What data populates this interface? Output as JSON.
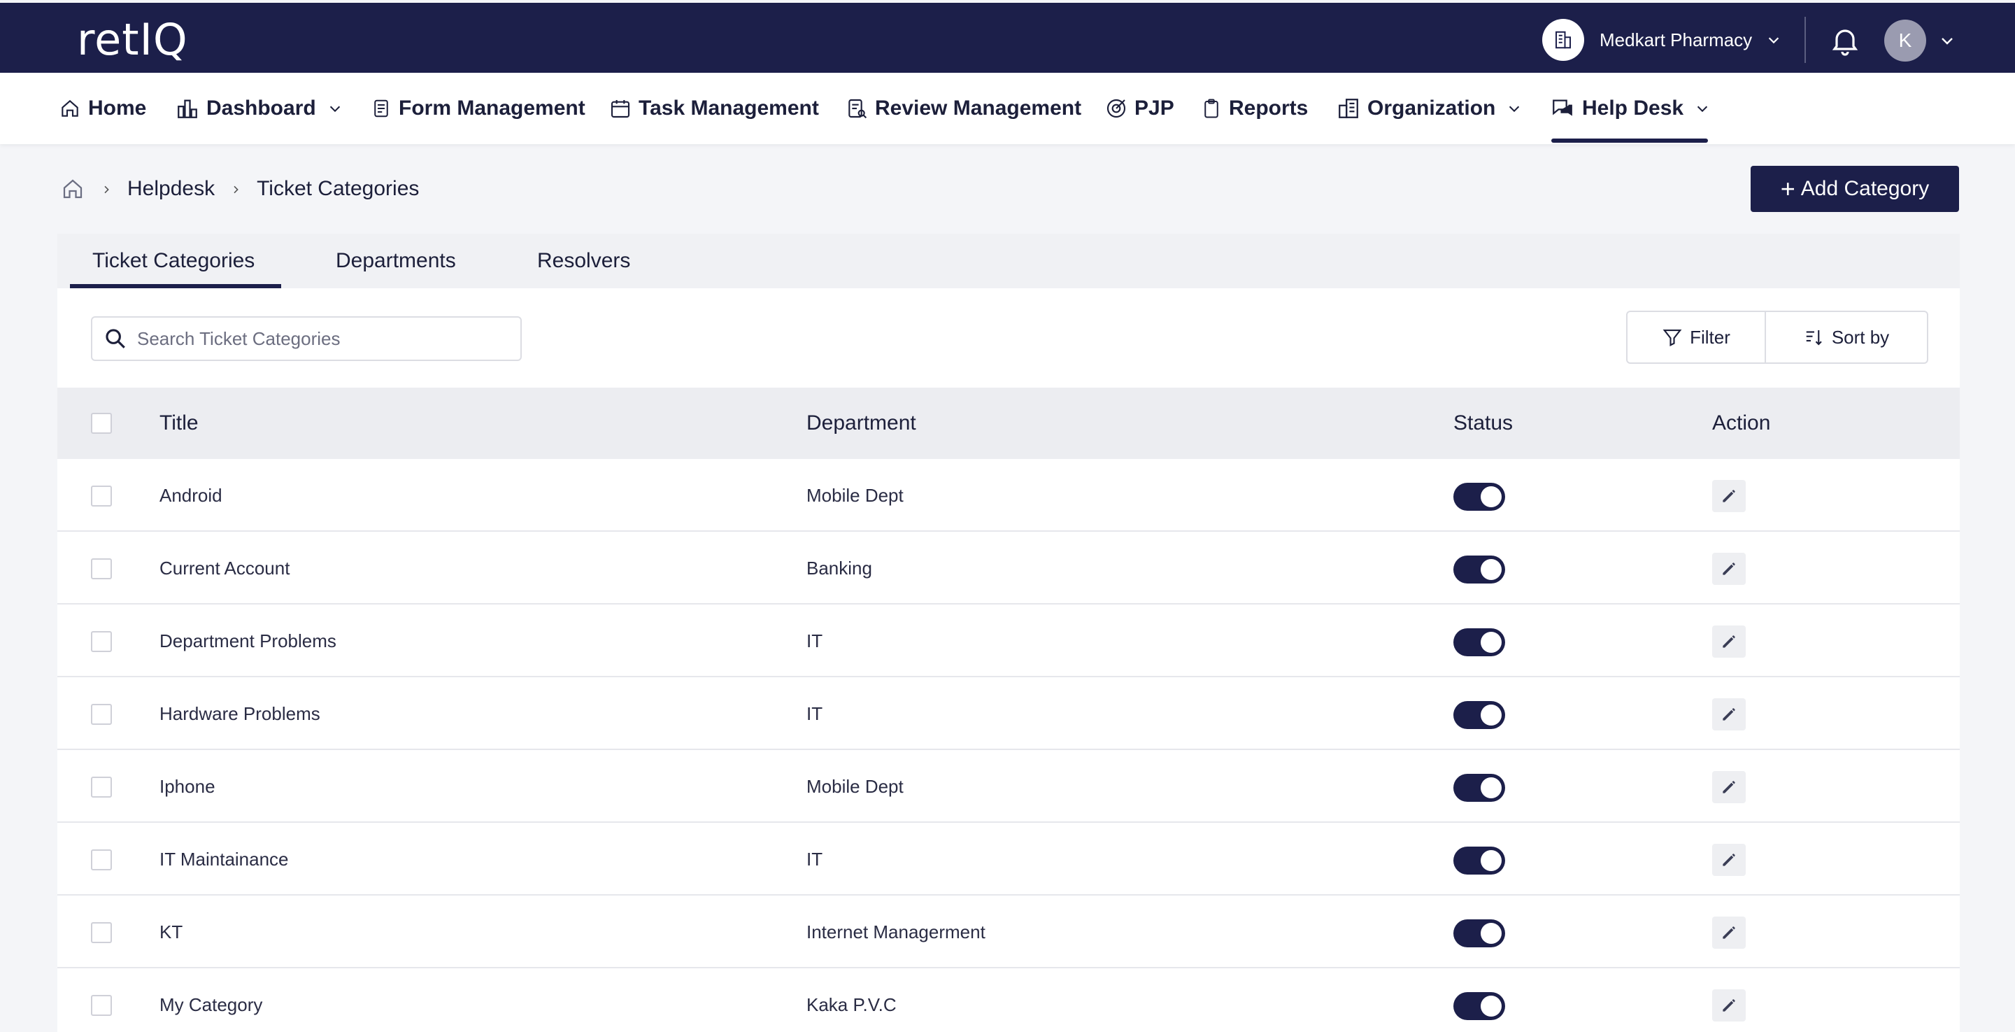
{
  "brand": {
    "logo_text": "retIQ"
  },
  "topbar": {
    "store_name": "Medkart Pharmacy",
    "avatar_initial": "K"
  },
  "nav": [
    {
      "label": "Home",
      "icon": "home-icon"
    },
    {
      "label": "Dashboard",
      "icon": "chart-icon"
    },
    {
      "label": "Form Management",
      "icon": "form-icon"
    },
    {
      "label": "Task Management",
      "icon": "calendar-icon"
    },
    {
      "label": "Review Management",
      "icon": "review-icon"
    },
    {
      "label": "PJP",
      "icon": "route-icon"
    },
    {
      "label": "Reports",
      "icon": "clipboard-icon"
    },
    {
      "label": "Organization",
      "icon": "building-icon"
    },
    {
      "label": "Help Desk",
      "icon": "chat-icon"
    }
  ],
  "breadcrumb": {
    "section": "Helpdesk",
    "current": "Ticket Categories"
  },
  "add_button": {
    "label": "Add Category"
  },
  "tabs": [
    "Ticket Categories",
    "Departments",
    "Resolvers"
  ],
  "search": {
    "placeholder": "Search Ticket Categories"
  },
  "toolbar": {
    "filter_label": "Filter",
    "sort_label": "Sort by"
  },
  "table": {
    "headers": {
      "title": "Title",
      "department": "Department",
      "status": "Status",
      "action": "Action"
    },
    "rows": [
      {
        "title": "Android",
        "department": "Mobile Dept",
        "active": true
      },
      {
        "title": "Current Account",
        "department": "Banking",
        "active": true
      },
      {
        "title": "Department Problems",
        "department": "IT",
        "active": true
      },
      {
        "title": "Hardware Problems",
        "department": "IT",
        "active": true
      },
      {
        "title": "Iphone",
        "department": "Mobile Dept",
        "active": true
      },
      {
        "title": "IT Maintainance",
        "department": "IT",
        "active": true
      },
      {
        "title": "KT",
        "department": "Internet Managerment",
        "active": true
      },
      {
        "title": "My Category",
        "department": "Kaka P.V.C",
        "active": true
      }
    ]
  },
  "colors": {
    "primary": "#1c1f4a",
    "background": "#f4f5f8",
    "header_row": "#ecedf1"
  }
}
